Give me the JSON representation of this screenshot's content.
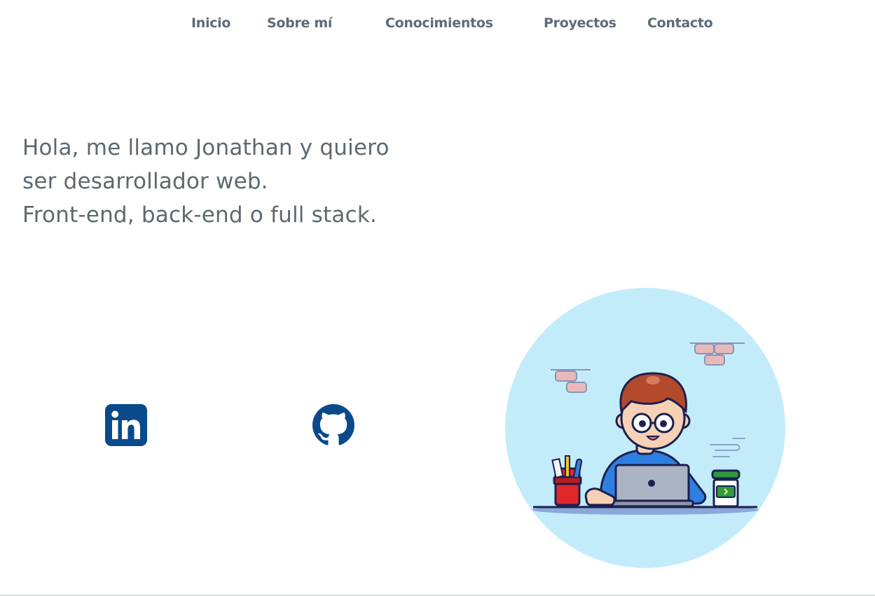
{
  "nav": {
    "items": [
      {
        "label": "Inicio"
      },
      {
        "label": "Sobre mí"
      },
      {
        "label": "Conocimientos"
      },
      {
        "label": "Proyectos"
      },
      {
        "label": "Contacto"
      }
    ]
  },
  "hero": {
    "lines": [
      "Hola, me llamo Jonathan y quiero",
      "ser desarrollador web.",
      "Front-end, back-end o full stack."
    ]
  },
  "social": {
    "linkedin_icon": "linkedin-icon",
    "github_icon": "github-icon"
  },
  "colors": {
    "nav_text": "#5f6b76",
    "body_text": "#5d6870",
    "social_icon": "#0a4a8a",
    "illustration_bg": "#c3ecfb"
  }
}
